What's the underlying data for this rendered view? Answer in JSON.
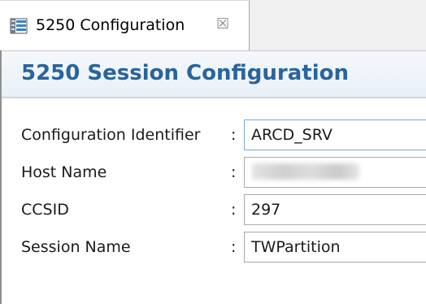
{
  "tab": {
    "label": "5250 Configuration",
    "icon": "config-table-icon",
    "close_icon": "close-icon",
    "close_glyph": "☒"
  },
  "page": {
    "title": "5250 Session Configuration"
  },
  "form": {
    "separator": ":",
    "fields": [
      {
        "label": "Configuration Identifier",
        "value": "ARCD_SRV"
      },
      {
        "label": "Host Name",
        "value": ""
      },
      {
        "label": "CCSID",
        "value": "297"
      },
      {
        "label": "Session Name",
        "value": "TWPartition"
      }
    ]
  },
  "colors": {
    "title": "#29649c",
    "header_band": "#e9f0f7"
  }
}
